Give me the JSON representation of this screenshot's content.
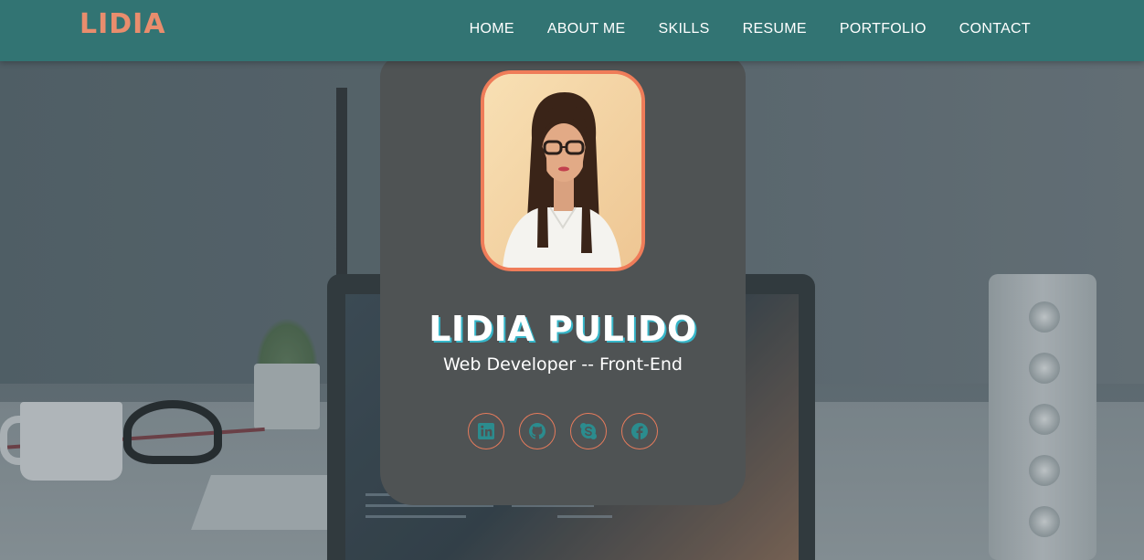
{
  "brand": {
    "logo_text": "LIDIA"
  },
  "nav": {
    "items": [
      {
        "label": "HOME"
      },
      {
        "label": "ABOUT ME"
      },
      {
        "label": "SKILLS"
      },
      {
        "label": "RESUME"
      },
      {
        "label": "PORTFOLIO"
      },
      {
        "label": "CONTACT"
      }
    ]
  },
  "profile": {
    "name": "LIDIA PULIDO",
    "role": "Web Developer -- Front-End",
    "photo_icon": "profile-photo"
  },
  "socials": [
    {
      "icon": "linkedin-icon"
    },
    {
      "icon": "github-icon"
    },
    {
      "icon": "skype-icon"
    },
    {
      "icon": "facebook-icon"
    }
  ],
  "colors": {
    "navbar": "#327473",
    "accent": "#ef7c59",
    "logo": "#e98d6d",
    "card": "#4f5354",
    "icon": "#2b8c8e",
    "name_shadow": "#36b6c9"
  }
}
